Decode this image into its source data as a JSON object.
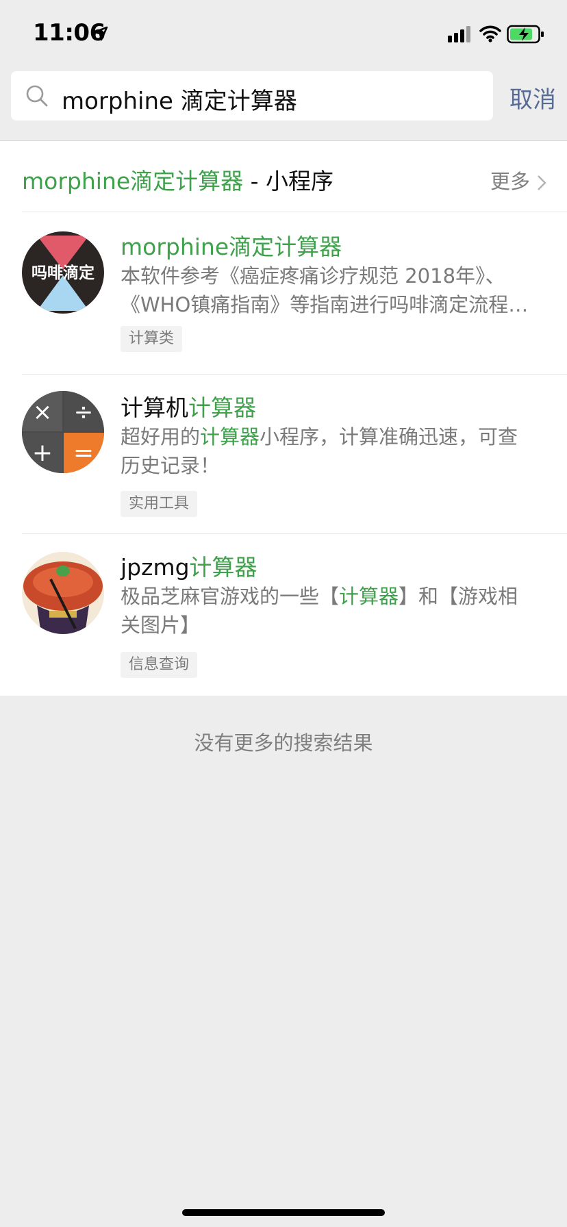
{
  "status": {
    "time": "11:06"
  },
  "search": {
    "query": "morphine 滴定计算器",
    "cancel": "取消"
  },
  "section": {
    "title_hl": "morphine滴定计算器",
    "title_rest": " - 小程序",
    "more": "更多"
  },
  "results": [
    {
      "title_hl": "morphine滴定计算器",
      "title_rest": "",
      "avatar_text": "吗啡滴定",
      "desc_line1": "本软件参考《癌症疼痛诊疗规范 2018年》、",
      "desc_line2": "《WHO镇痛指南》等指南进行吗啡滴定流程…",
      "tag": "计算类"
    },
    {
      "title_pre": "计算机",
      "title_hl": "计算器",
      "avatar_symbols": [
        "×",
        "÷",
        "+",
        "="
      ],
      "desc_a": "超好用的",
      "desc_hl": "计算器",
      "desc_b": "小程序，计算准确迅速，可查",
      "desc_line2": "历史记录！",
      "tag": "实用工具"
    },
    {
      "title_pre": "jpzmg",
      "title_hl": "计算器",
      "desc_a": "极品芝麻官游戏的一些【",
      "desc_hl": "计算器",
      "desc_b": "】和【游戏相",
      "desc_line2": "关图片】",
      "tag": "信息查询"
    }
  ],
  "footer": {
    "no_more": "没有更多的搜索结果"
  },
  "colors": {
    "highlight": "#3fa14b",
    "link": "#576b95",
    "background": "#ededed"
  },
  "icons": [
    "location-arrow-icon",
    "cellular-signal-icon",
    "wifi-icon",
    "battery-charging-icon",
    "search-icon",
    "chevron-right-icon"
  ]
}
